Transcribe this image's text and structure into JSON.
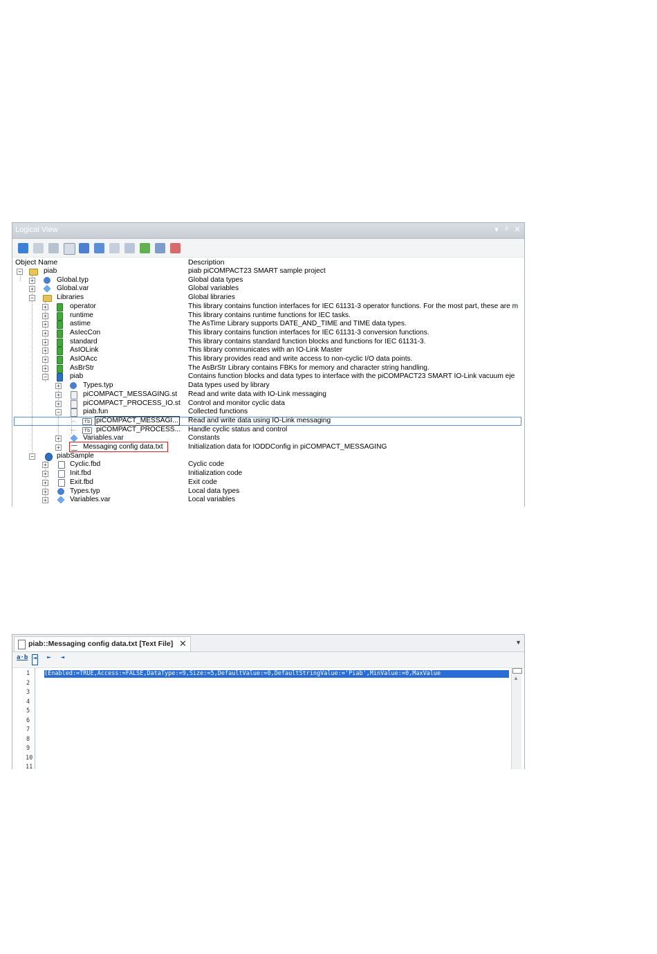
{
  "logical_view": {
    "title": "Logical View",
    "controls": [
      "▾",
      "ᵖ",
      "✕"
    ],
    "toolbar_icons": [
      "new-object-icon",
      "table-icon",
      "properties-icon",
      "package-icon",
      "reorder-icon",
      "edit-icon",
      "refresh-icon",
      "library-icon",
      "move-icon",
      "print-icon",
      "delete-icon"
    ],
    "columns": {
      "object_name": "Object Name",
      "description": "Description"
    },
    "rows": [
      {
        "name": "piab",
        "desc": "piab piCOMPACT23 SMART sample project"
      },
      {
        "name": "Global.typ",
        "desc": "Global data types"
      },
      {
        "name": "Global.var",
        "desc": "Global variables"
      },
      {
        "name": "Libraries",
        "desc": "Global libraries"
      },
      {
        "name": "operator",
        "desc": "This library contains function interfaces for IEC 61131-3 operator functions. For the most part, these are m"
      },
      {
        "name": "runtime",
        "desc": "This library contains runtime functions for IEC tasks."
      },
      {
        "name": "astime",
        "desc": "The AsTime Library supports DATE_AND_TIME and TIME data types."
      },
      {
        "name": "AsIecCon",
        "desc": "This library contains function interfaces for IEC 61131-3 conversion functions."
      },
      {
        "name": "standard",
        "desc": "This library contains standard function blocks and functions for IEC 61131-3."
      },
      {
        "name": "AsIOLink",
        "desc": "This library communicates with an IO-Link Master"
      },
      {
        "name": "AsIOAcc",
        "desc": "This library provides read and write access to non-cyclic I/O data points."
      },
      {
        "name": "AsBrStr",
        "desc": "The AsBrStr Library contains FBKs for memory and character string handling."
      },
      {
        "name": "piab",
        "desc": "Contains function blocks and data types to interface with the piCOMPACT23 SMART IO-Link vacuum eje"
      },
      {
        "name": "Types.typ",
        "desc": "Data types used by library"
      },
      {
        "name": "piCOMPACT_MESSAGING.st",
        "desc": "Read and write data with IO-Link messaging"
      },
      {
        "name": "piCOMPACT_PROCESS_IO.st",
        "desc": "Control and monitor cyclic data"
      },
      {
        "name": "piab.fun",
        "desc": "Collected functions"
      },
      {
        "name": "piCOMPACT_MESSAGI...",
        "desc": "Read and write data using IO-Link messaging"
      },
      {
        "name": "piCOMPACT_PROCESS...",
        "desc": "Handle cyclic status and control"
      },
      {
        "name": "Variables.var",
        "desc": "Constants"
      },
      {
        "name": "Messaging config data.txt",
        "desc": "Initialization data for IODDConfig in piCOMPACT_MESSAGING"
      },
      {
        "name": "piabSample",
        "desc": ""
      },
      {
        "name": "Cyclic.fbd",
        "desc": "Cyclic code"
      },
      {
        "name": "Init.fbd",
        "desc": "Initialization code"
      },
      {
        "name": "Exit.fbd",
        "desc": "Exit code"
      },
      {
        "name": "Types.typ",
        "desc": "Local data types"
      },
      {
        "name": "Variables.var",
        "desc": "Local variables"
      }
    ]
  },
  "editor": {
    "tab_label": "piab::Messaging config data.txt [Text File]",
    "tab_close": "✕",
    "dropdown": "▼",
    "toolbar": [
      "a·b",
      "⇥",
      "⇤",
      "⇥"
    ],
    "line_numbers": [
      "1",
      "2",
      "3",
      "4",
      "5",
      "6",
      "7",
      "8",
      "9",
      "10",
      "11"
    ],
    "code_line_1": "(Enabled:=TRUE,Access:=FALSE,DataType:=9,Size:=5,DefaultValue:=0,DefaultStringValue:='Piab',MinValue:=0,MaxValue"
  }
}
